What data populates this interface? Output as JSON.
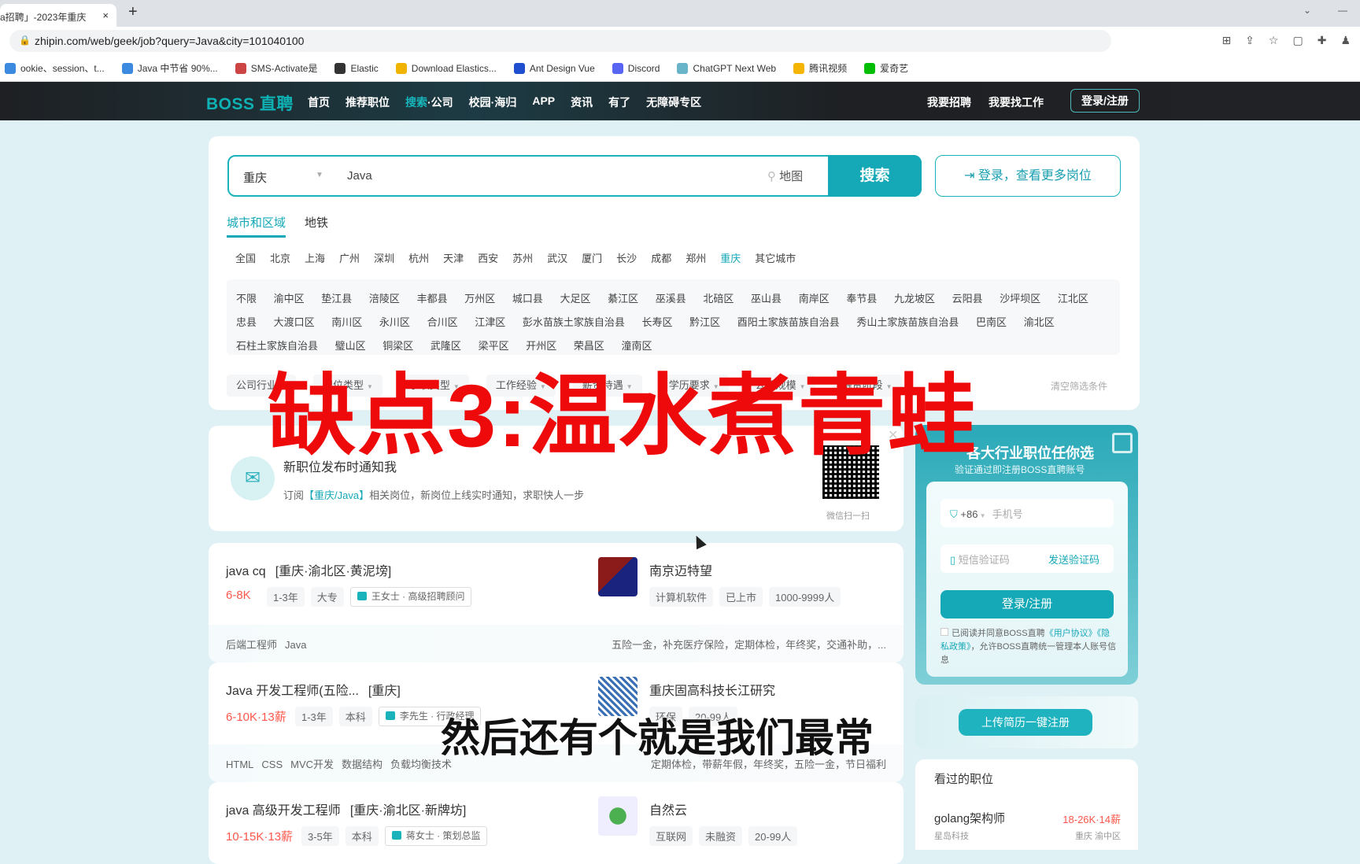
{
  "browser": {
    "tab_title": "a招聘」-2023年重庆",
    "tab_close": "×",
    "new_tab": "+",
    "url": "zhipin.com/web/geek/job?query=Java&city=101040100",
    "bookmarks": [
      {
        "label": "ookie、session、t...",
        "icon": "diamond-icon",
        "color": "#3b8ae0"
      },
      {
        "label": "Java 中节省 90%...",
        "icon": "diamond-icon",
        "color": "#3b8ae0"
      },
      {
        "label": "SMS-Activate是",
        "icon": "globe-icon",
        "color": "#c44"
      },
      {
        "label": "Elastic",
        "icon": "globe-icon",
        "color": "#333"
      },
      {
        "label": "Download Elastics...",
        "icon": "elastic-icon",
        "color": "#f0b400"
      },
      {
        "label": "Ant Design Vue",
        "icon": "vue-icon",
        "color": "#1f4fcf"
      },
      {
        "label": "Discord",
        "icon": "discord-icon",
        "color": "#5865f2"
      },
      {
        "label": "ChatGPT Next Web",
        "icon": "chatgpt-icon",
        "color": "#69b4c9"
      },
      {
        "label": "腾讯视频",
        "icon": "play-icon",
        "color": "#f4b400"
      },
      {
        "label": "爱奇艺",
        "icon": "iqiyi-icon",
        "color": "#00be06"
      }
    ]
  },
  "nav": {
    "logo": "BOSS 直聘",
    "links": [
      "首页",
      "推荐职位"
    ],
    "search_highlight": "搜索",
    "search_rest": "·公司",
    "links2": [
      "校园·海归",
      "APP",
      "资讯",
      "有了",
      "无障碍专区"
    ],
    "right_links": [
      "我要招聘",
      "我要找工作"
    ],
    "login": "登录/注册"
  },
  "search": {
    "city": "重庆",
    "query": "Java",
    "map": "地图",
    "button": "搜索",
    "login_more": "登录，查看更多岗位"
  },
  "region_tabs": [
    "城市和区域",
    "地铁"
  ],
  "cities": [
    "全国",
    "北京",
    "上海",
    "广州",
    "深圳",
    "杭州",
    "天津",
    "西安",
    "苏州",
    "武汉",
    "厦门",
    "长沙",
    "成都",
    "郑州",
    "重庆",
    "其它城市"
  ],
  "selected_city": "重庆",
  "districts": [
    "不限",
    "渝中区",
    "垫江县",
    "涪陵区",
    "丰都县",
    "万州区",
    "城口县",
    "大足区",
    "綦江区",
    "巫溪县",
    "北碚区",
    "巫山县",
    "南岸区",
    "奉节县",
    "九龙坡区",
    "云阳县",
    "沙坪坝区",
    "江北区",
    "忠县",
    "大渡口区",
    "南川区",
    "永川区",
    "合川区",
    "江津区",
    "彭水苗族土家族自治县",
    "长寿区",
    "黔江区",
    "酉阳土家族苗族自治县",
    "秀山土家族苗族自治县",
    "巴南区",
    "渝北区",
    "石柱土家族自治县",
    "璧山区",
    "铜梁区",
    "武隆区",
    "梁平区",
    "开州区",
    "荣昌区",
    "潼南区"
  ],
  "filters": [
    "公司行业",
    "职位类型",
    "求职类型",
    "工作经验",
    "薪资待遇",
    "学历要求",
    "公司规模",
    "融资阶段"
  ],
  "clear_filters": "清空筛选条件",
  "subscribe": {
    "title": "新职位发布时通知我",
    "desc_prefix": "订阅",
    "desc_keyword": "【重庆/Java】",
    "desc_suffix": "相关岗位，新岗位上线实时通知，求职快人一步",
    "qr_label": "微信扫一扫"
  },
  "jobs": [
    {
      "title": "java cq",
      "location": "[重庆·渝北区·黄泥塝]",
      "salary": "6-8K",
      "tags": [
        "1-3年",
        "大专"
      ],
      "recruiter": "王女士 · 高级招聘顾问",
      "company": "南京迈特望",
      "company_tags": [
        "计算机软件",
        "已上市",
        "1000-9999人"
      ],
      "skills": [
        "后端工程师",
        "Java"
      ],
      "benefits": "五险一金，补充医疗保险，定期体检，年终奖，交通补助，..."
    },
    {
      "title": "Java 开发工程师(五险...",
      "location": "[重庆]",
      "salary": "6-10K·13薪",
      "tags": [
        "1-3年",
        "本科"
      ],
      "recruiter": "李先生 · 行政经理",
      "company": "重庆固高科技长江研究",
      "company_tags": [
        "环保",
        "20-99人"
      ],
      "skills": [
        "HTML",
        "CSS",
        "MVC开发",
        "数据结构",
        "负载均衡技术"
      ],
      "benefits": "定期体检，带薪年假，年终奖，五险一金，节日福利"
    },
    {
      "title": "java 高级开发工程师",
      "location": "[重庆·渝北区·新牌坊]",
      "salary": "10-15K·13薪",
      "tags": [
        "3-5年",
        "本科"
      ],
      "recruiter": "蒋女士 · 策划总监",
      "company": "自然云",
      "company_tags": [
        "互联网",
        "未融资",
        "20-99人"
      ],
      "skills": [],
      "benefits": ""
    }
  ],
  "sidebar": {
    "title": "各大行业职位任你选",
    "subtitle": "验证通过即注册BOSS直聘账号",
    "country_code": "+86",
    "phone_placeholder": "手机号",
    "code_placeholder": "短信验证码",
    "send_code": "发送验证码",
    "register": "登录/注册",
    "agree_text": "已阅读并同意BOSS直聘",
    "agree_link1": "《用户协议》",
    "agree_link2": "《隐私政策》",
    "agree_rest": "，允许BOSS直聘统一管理本人账号信息",
    "upload": "上传简历一键注册"
  },
  "history": {
    "title": "看过的职位",
    "job": "golang架构师",
    "salary": "18-26K·14薪",
    "company": "星岛科技",
    "location": "重庆 渝中区"
  },
  "overlay": {
    "headline": "缺点3:温水煮青蛙",
    "subtitle": "然后还有个就是我们最常"
  }
}
